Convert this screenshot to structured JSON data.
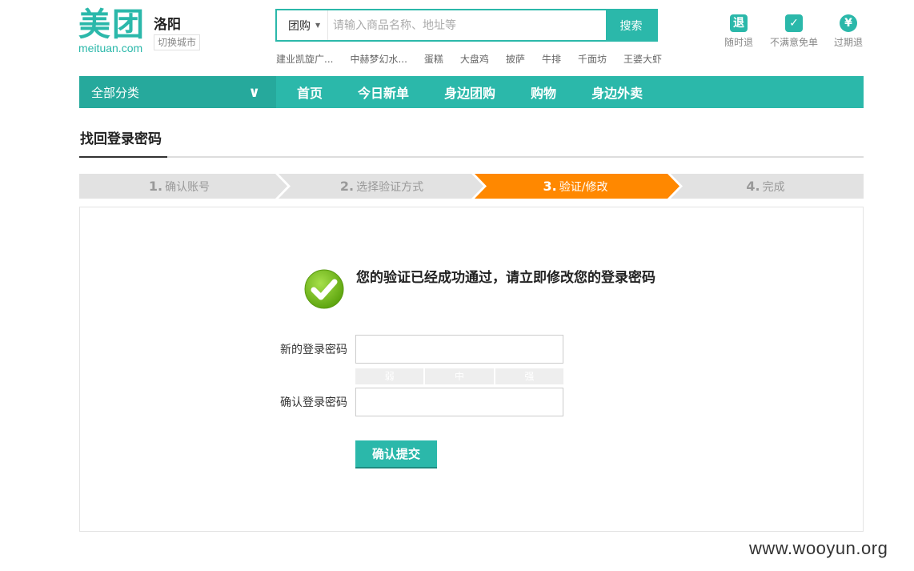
{
  "header": {
    "logo_mark": "美团",
    "logo_domain": "meituan.com",
    "city": "洛阳",
    "switch_city": "切换城市"
  },
  "search": {
    "scope": "团购",
    "placeholder": "请输入商品名称、地址等",
    "button": "搜索",
    "hot_words": [
      "建业凯旋广...",
      "中赫梦幻水...",
      "蛋糕",
      "大盘鸡",
      "披萨",
      "牛排",
      "千面坊",
      "王婆大虾"
    ]
  },
  "guarantees": [
    {
      "label": "随时退",
      "icon": "refund-icon"
    },
    {
      "label": "不满意免单",
      "icon": "check-shield-icon"
    },
    {
      "label": "过期退",
      "icon": "yuan-icon"
    }
  ],
  "nav": {
    "category": "全部分类",
    "links": [
      "首页",
      "今日新单",
      "身边团购",
      "购物",
      "身边外卖"
    ]
  },
  "page_title": "找回登录密码",
  "steps": [
    {
      "num": "1.",
      "label": "确认账号",
      "active": false
    },
    {
      "num": "2.",
      "label": "选择验证方式",
      "active": false
    },
    {
      "num": "3.",
      "label": "验证/修改",
      "active": true
    },
    {
      "num": "4.",
      "label": "完成",
      "active": false
    }
  ],
  "form": {
    "success_message": "您的验证已经成功通过，请立即修改您的登录密码",
    "new_password_label": "新的登录密码",
    "new_password_value": "",
    "strength": [
      "弱",
      "中",
      "强"
    ],
    "confirm_password_label": "确认登录密码",
    "confirm_password_value": "",
    "submit": "确认提交"
  },
  "colors": {
    "brand": "#2bb8aa",
    "active_step": "#ff8800",
    "success": "#7cc11f"
  },
  "watermark": "www.wooyun.org"
}
